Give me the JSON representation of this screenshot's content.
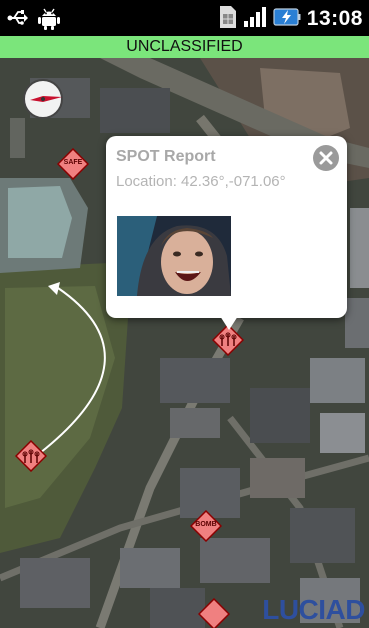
{
  "status_bar": {
    "time": "13:08",
    "icons": [
      "usb-icon",
      "android-debug-icon",
      "sim-card-icon",
      "signal-icon",
      "battery-charging-icon"
    ]
  },
  "banner": {
    "label": "UNCLASSIFIED"
  },
  "popup": {
    "title": "SPOT Report",
    "location": "Location: 42.36°,-071.06°"
  },
  "markers": [
    {
      "label": "SAFE"
    },
    {
      "label": ""
    },
    {
      "label": ""
    },
    {
      "label": "BOMB"
    },
    {
      "label": ""
    }
  ],
  "logo": {
    "text": "LUCIAD"
  },
  "colors": {
    "banner": "#7be57b",
    "marker_fill": "#f08080",
    "marker_border": "#8b0000",
    "logo": "#2e4f9e"
  }
}
